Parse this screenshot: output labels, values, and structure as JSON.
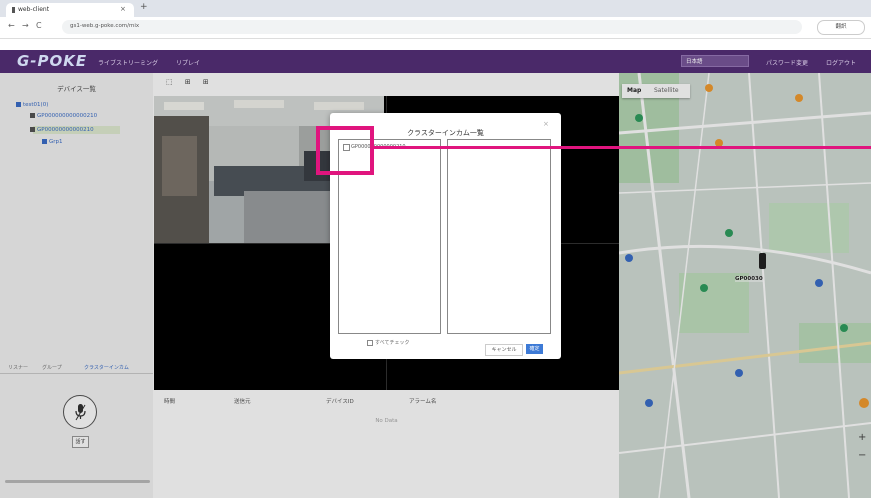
{
  "browser": {
    "tab_title": "web-client",
    "tab_close": "×",
    "new_tab": "+",
    "back": "←",
    "forward": "→",
    "reload": "C",
    "url": "gs1-web.g-poke.com/mix",
    "translate_label": "翻訳"
  },
  "header": {
    "logo": "G-POKE",
    "nav": [
      "ライブストリーミング",
      "リプレイ"
    ],
    "language": "日本語",
    "password_change": "パスワード変更",
    "logout": "ログアウト"
  },
  "sidebar": {
    "title": "デバイス一覧",
    "tree": [
      {
        "label": "test01(0)"
      },
      {
        "label": "GP000000000000210"
      },
      {
        "label": "GP00000000000210"
      },
      {
        "label": "Grp1"
      }
    ],
    "tabs": [
      "リスナー",
      "グループ",
      "クラスターインカム"
    ],
    "talk_button": "話す"
  },
  "main": {
    "layout_icons": "⬚ ⊞ ⊞",
    "table_headers": [
      "時間",
      "送信元",
      "デバイスID",
      "アラーム名"
    ],
    "no_data": "No Data"
  },
  "map": {
    "map_label": "Map",
    "satellite_label": "Satellite",
    "device_label": "GP00030",
    "zoom_in": "+",
    "zoom_out": "−"
  },
  "modal": {
    "title": "クラスターインカム一覧",
    "close": "×",
    "item_label": "GP000000000000210",
    "check_all": "すべてチェック",
    "cancel": "キャンセル",
    "ok": "確定"
  },
  "colors": {
    "header_bg": "#4a2969",
    "callout": "#e0157e",
    "primary_button": "#3d7ad6"
  }
}
